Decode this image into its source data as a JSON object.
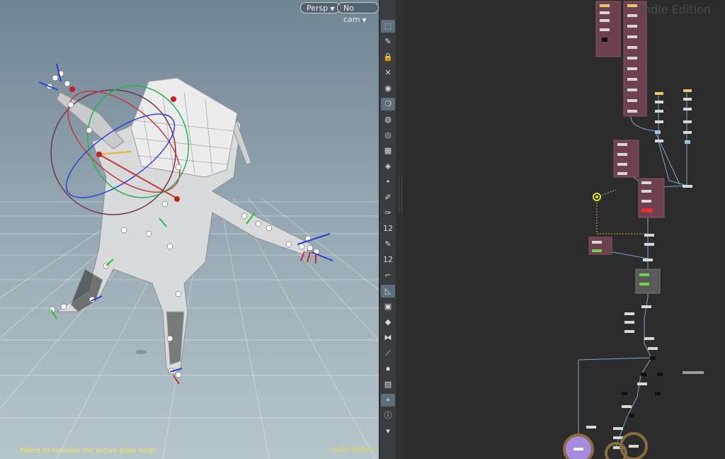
{
  "viewport": {
    "camera_menu": "Persp",
    "cam_menu": "No cam",
    "status_message": "Failed to retrieve the active pose node",
    "edition_label": "Indie Edition"
  },
  "toolbar": {
    "tools": [
      {
        "icon": "select-icon",
        "glyph": "⬚",
        "active": true
      },
      {
        "icon": "pose-icon",
        "glyph": "✎",
        "active": false
      },
      {
        "icon": "lock-icon",
        "glyph": "🔒",
        "active": false
      },
      {
        "icon": "pin-icon",
        "glyph": "✕",
        "active": false
      },
      {
        "icon": "sphere-icon",
        "glyph": "◉",
        "active": false
      },
      {
        "icon": "bone-icon",
        "glyph": "❍",
        "active": true
      },
      {
        "icon": "light-icon",
        "glyph": "◍",
        "active": false
      },
      {
        "icon": "capture-icon",
        "glyph": "◎",
        "active": false
      },
      {
        "icon": "checker-icon",
        "glyph": "▦",
        "active": false
      },
      {
        "icon": "camera-icon",
        "glyph": "◈",
        "active": false
      },
      {
        "icon": "dot-icon",
        "glyph": "•",
        "active": false
      },
      {
        "icon": "brush-icon",
        "glyph": "✐",
        "active": false
      },
      {
        "icon": "paint-icon",
        "glyph": "✑",
        "active": false
      },
      {
        "icon": "count-icon",
        "glyph": "12",
        "active": false
      },
      {
        "icon": "eraser-icon",
        "glyph": "✎",
        "active": false
      },
      {
        "icon": "count2-icon",
        "glyph": "12",
        "active": false
      },
      {
        "icon": "corner-icon",
        "glyph": "⌐",
        "active": false
      },
      {
        "icon": "flat-icon",
        "glyph": "◺",
        "active": true
      },
      {
        "icon": "grid-icon",
        "glyph": "▣",
        "active": false
      },
      {
        "icon": "diamond-icon",
        "glyph": "◆",
        "active": false
      },
      {
        "icon": "bowtie-icon",
        "glyph": "⧓",
        "active": false
      },
      {
        "icon": "joint-icon",
        "glyph": "⟋",
        "active": false
      },
      {
        "icon": "stop-icon",
        "glyph": "⏹",
        "active": false
      },
      {
        "icon": "image-icon",
        "glyph": "▨",
        "active": false
      },
      {
        "icon": "locate-icon",
        "glyph": "⌖",
        "active": true
      },
      {
        "icon": "info-icon",
        "glyph": "ⓘ",
        "active": false
      },
      {
        "icon": "expand-icon",
        "glyph": "▾",
        "active": false
      }
    ]
  },
  "network": {
    "watermark": "Indie Edition"
  }
}
